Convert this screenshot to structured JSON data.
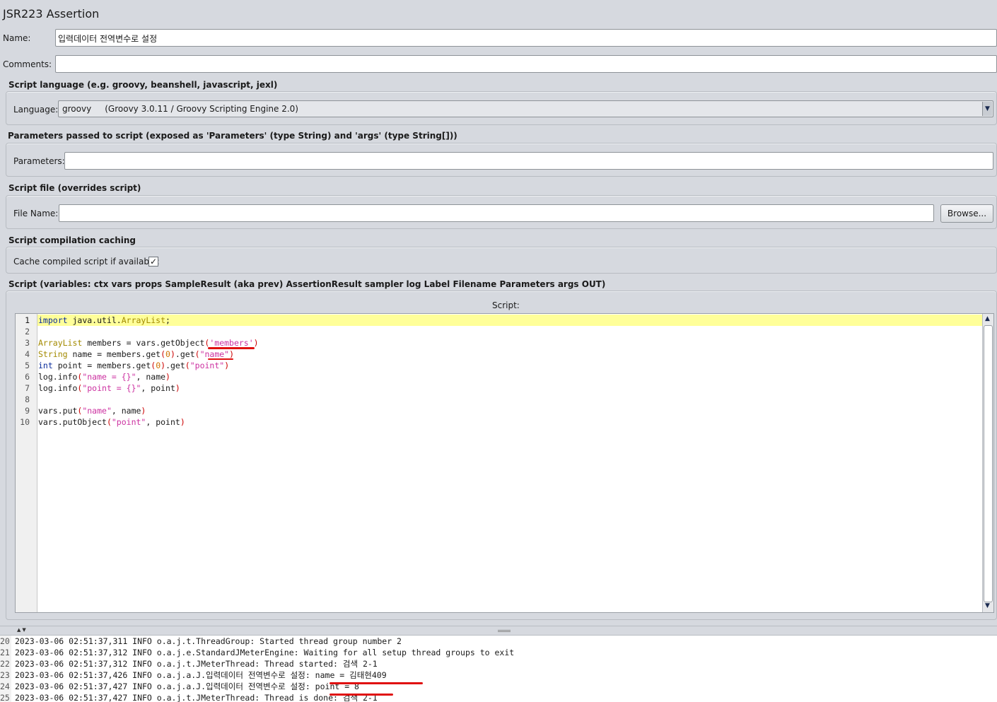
{
  "header": {
    "title": "JSR223 Assertion"
  },
  "name_field": {
    "label": "Name:",
    "value": "입력데이터 전역변수로 설정"
  },
  "comments_field": {
    "label": "Comments:",
    "value": ""
  },
  "script_language": {
    "section_title": "Script language (e.g. groovy, beanshell, javascript, jexl)",
    "label": "Language:",
    "selected": "groovy     (Groovy 3.0.11 / Groovy Scripting Engine 2.0)"
  },
  "parameters": {
    "section_title": "Parameters passed to script (exposed as 'Parameters' (type String) and 'args' (type String[]))",
    "label": "Parameters:",
    "value": ""
  },
  "script_file": {
    "section_title": "Script file (overrides script)",
    "label": "File Name:",
    "value": "",
    "browse_label": "Browse..."
  },
  "caching": {
    "section_title": "Script compilation caching",
    "label": "Cache compiled script if available:",
    "checked": true,
    "check_glyph": "✓"
  },
  "script": {
    "section_title": "Script (variables: ctx vars props SampleResult (aka prev) AssertionResult sampler log Label Filename Parameters args OUT)",
    "editor_title": "Script:",
    "line_numbers": [
      "1",
      "2",
      "3",
      "4",
      "5",
      "6",
      "7",
      "8",
      "9",
      "10"
    ],
    "lines": [
      "import java.util.ArrayList;",
      "",
      "ArrayList members = vars.getObject('members')",
      "String name = members.get(0).get(\"name\")",
      "int point = members.get(0).get(\"point\")",
      "log.info(\"name = {}\", name)",
      "log.info(\"point = {}\", point)",
      "",
      "vars.put(\"name\", name)",
      "vars.putObject(\"point\", point)"
    ]
  },
  "splitter": {
    "arrows": "▲▼"
  },
  "log": {
    "line_numbers": [
      "20",
      "21",
      "22",
      "23",
      "24",
      "25"
    ],
    "lines": [
      "2023-03-06 02:51:37,311 INFO o.a.j.t.ThreadGroup: Started thread group number 2",
      "2023-03-06 02:51:37,312 INFO o.a.j.e.StandardJMeterEngine: Waiting for all setup thread groups to exit",
      "2023-03-06 02:51:37,312 INFO o.a.j.t.JMeterThread: Thread started: 검색 2-1",
      "2023-03-06 02:51:37,426 INFO o.a.j.a.J.입력데이터 전역변수로 설정: name = 김태현409",
      "2023-03-06 02:51:37,427 INFO o.a.j.a.J.입력데이터 전역변수로 설정: point = 8",
      "2023-03-06 02:51:37,427 INFO o.a.j.t.JMeterThread: Thread is done: 검색 2-1"
    ]
  },
  "colors": {
    "background": "#d6d9df",
    "highlight_line": "#ffff99",
    "annotation_red": "#e01010"
  }
}
